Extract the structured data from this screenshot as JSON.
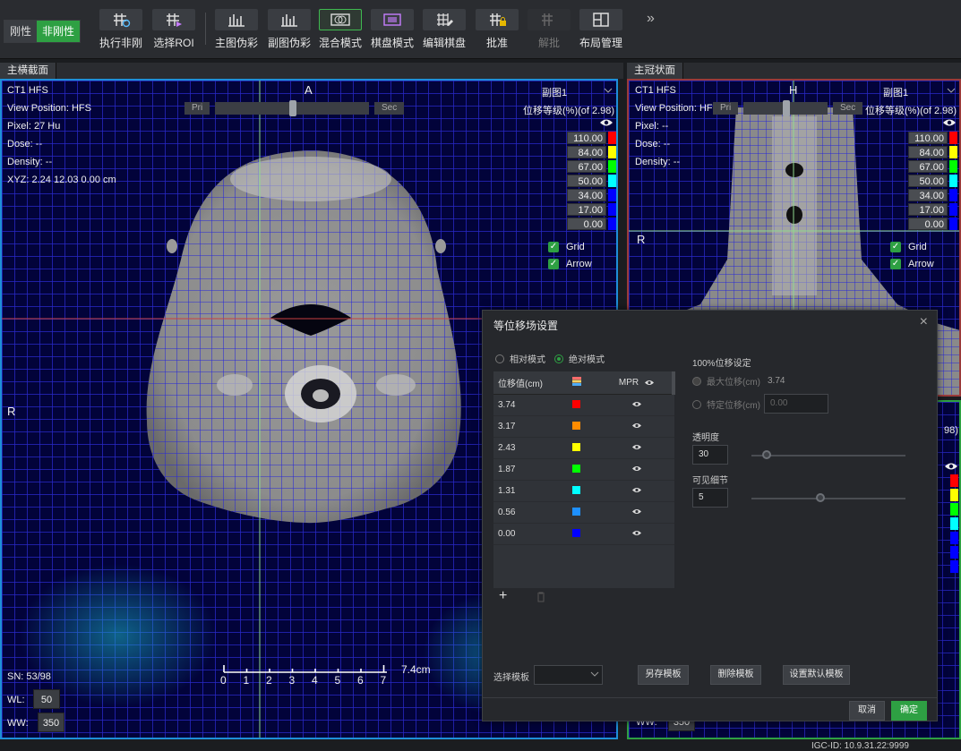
{
  "toolbar": {
    "mode_rigid": "刚性",
    "mode_nonrigid": "非刚性",
    "buttons": [
      {
        "label": "执行非刚",
        "icon": "grid-run-icon"
      },
      {
        "label": "选择ROI",
        "icon": "grid-roi-icon"
      },
      {
        "label": "主图伪彩",
        "icon": "primary-pseudocolor-icon"
      },
      {
        "label": "副图伪彩",
        "icon": "secondary-pseudocolor-icon"
      },
      {
        "label": "混合模式",
        "icon": "blend-mode-icon"
      },
      {
        "label": "棋盘模式",
        "icon": "checkerboard-icon"
      },
      {
        "label": "编辑棋盘",
        "icon": "edit-checkerboard-icon"
      },
      {
        "label": "批准",
        "icon": "approve-lock-icon"
      },
      {
        "label": "解批",
        "icon": "unapprove-icon"
      },
      {
        "label": "布局管理",
        "icon": "layout-icon"
      }
    ],
    "more": "»"
  },
  "left_panel": {
    "header": "主横截面",
    "orient_top": "A",
    "orient_left": "R",
    "info": [
      "CT1 HFS",
      "View Position: HFS",
      "Pixel:  27 Hu",
      "Dose:  --",
      "Density:  --",
      "XYZ: 2.24 12.03 0.00 cm"
    ],
    "pri": "Pri",
    "sec": "Sec",
    "secondary": "副图1",
    "level_title": "位移等级(%)(of 2.98)",
    "levels": [
      "110.00",
      "84.00",
      "67.00",
      "50.00",
      "34.00",
      "17.00",
      "0.00"
    ],
    "level_colors": [
      "#ff0000",
      "#ffff00",
      "#00ff00",
      "#00ffff",
      "#0000ff",
      "#0000ff",
      "#0000ff"
    ],
    "grid": "Grid",
    "arrow": "Arrow",
    "sn": "SN: 53/98",
    "wl_label": "WL:",
    "wl": "50",
    "ww_label": "WW:",
    "ww": "350",
    "scale_ticks": [
      "0",
      "1",
      "2",
      "3",
      "4",
      "5",
      "6",
      "7"
    ],
    "scale_unit": "7.4cm"
  },
  "right_panel": {
    "header": "主冠状面",
    "orient_top": "H",
    "orient_left": "R",
    "info": [
      "CT1 HFS",
      "View Position: HFS",
      "Pixel:  --",
      "Dose:  --",
      "Density:  --"
    ],
    "pri": "Pri",
    "sec": "Sec",
    "secondary": "副图1",
    "level_title": "位移等级(%)(of 2.98)",
    "levels": [
      "110.00",
      "84.00",
      "67.00",
      "50.00",
      "34.00",
      "17.00",
      "0.00"
    ],
    "grid": "Grid",
    "arrow": "Arrow",
    "lower_partial": "98)",
    "lower_ww_label": "WW:",
    "lower_ww": "350"
  },
  "status": {
    "igc": "IGC-ID: 10.9.31.22:9999"
  },
  "dialog": {
    "title": "等位移场设置",
    "close": "×",
    "mode_relative": "相对模式",
    "mode_absolute": "绝对模式",
    "col_value": "位移值(cm)",
    "col_mpr": "MPR",
    "rows": [
      {
        "value": "3.74",
        "color": "#ff0000"
      },
      {
        "value": "3.17",
        "color": "#ff8c00"
      },
      {
        "value": "2.43",
        "color": "#ffff00"
      },
      {
        "value": "1.87",
        "color": "#00ff00"
      },
      {
        "value": "1.31",
        "color": "#00ffff"
      },
      {
        "value": "0.56",
        "color": "#1e90ff"
      },
      {
        "value": "0.00",
        "color": "#0000ff"
      }
    ],
    "add": "+",
    "section_100": "100%位移设定",
    "max_disp_label": "最大位移(cm)",
    "max_disp_value": "3.74",
    "specific_label": "特定位移(cm)",
    "specific_value": "0.00",
    "opacity_label": "透明度",
    "opacity_value": "30",
    "opacity_fraction": 0.1,
    "detail_label": "可见细节",
    "detail_value": "5",
    "detail_fraction": 0.45,
    "template_label": "选择模板",
    "save_template": "另存模板",
    "delete_template": "删除模板",
    "default_template": "设置默认模板",
    "cancel": "取消",
    "ok": "确定"
  }
}
